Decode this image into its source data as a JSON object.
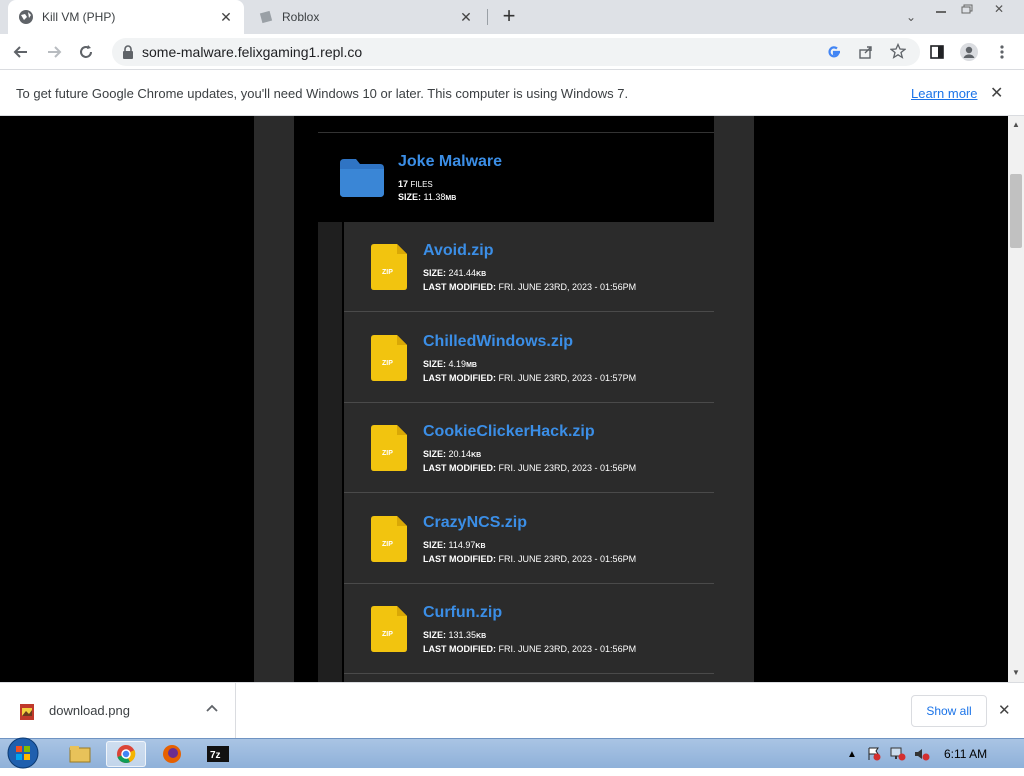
{
  "tabs": [
    {
      "title": "Kill VM (PHP)",
      "active": true
    },
    {
      "title": "Roblox",
      "active": false
    }
  ],
  "address": {
    "url": "some-malware.felixgaming1.repl.co"
  },
  "infobar": {
    "message": "To get future Google Chrome updates, you'll need Windows 10 or later. This computer is using Windows 7.",
    "link": "Learn more"
  },
  "folder": {
    "name": "Joke Malware",
    "files_count": "17",
    "files_label": "FILES",
    "size_label": "SIZE:",
    "size_value": "11.38",
    "size_unit": "MB"
  },
  "file_labels": {
    "size": "SIZE:",
    "modified": "LAST MODIFIED:",
    "zip": "ZIP"
  },
  "files": [
    {
      "name": "Avoid.zip",
      "size": "241.44",
      "unit": "KB",
      "modified": "FRI. JUNE 23RD, 2023 - 01:56PM"
    },
    {
      "name": "ChilledWindows.zip",
      "size": "4.19",
      "unit": "MB",
      "modified": "FRI. JUNE 23RD, 2023 - 01:57PM"
    },
    {
      "name": "CookieClickerHack.zip",
      "size": "20.14",
      "unit": "KB",
      "modified": "FRI. JUNE 23RD, 2023 - 01:56PM"
    },
    {
      "name": "CrazyNCS.zip",
      "size": "114.97",
      "unit": "KB",
      "modified": "FRI. JUNE 23RD, 2023 - 01:56PM"
    },
    {
      "name": "Curfun.zip",
      "size": "131.35",
      "unit": "KB",
      "modified": "FRI. JUNE 23RD, 2023 - 01:56PM"
    }
  ],
  "downloads": {
    "file": "download.png",
    "show_all": "Show all"
  },
  "taskbar": {
    "clock": "6:11 AM"
  },
  "colors": {
    "link_blue": "#3b8ee6",
    "zip_yellow": "#f2c40f",
    "folder_blue": "#3a86d6"
  }
}
